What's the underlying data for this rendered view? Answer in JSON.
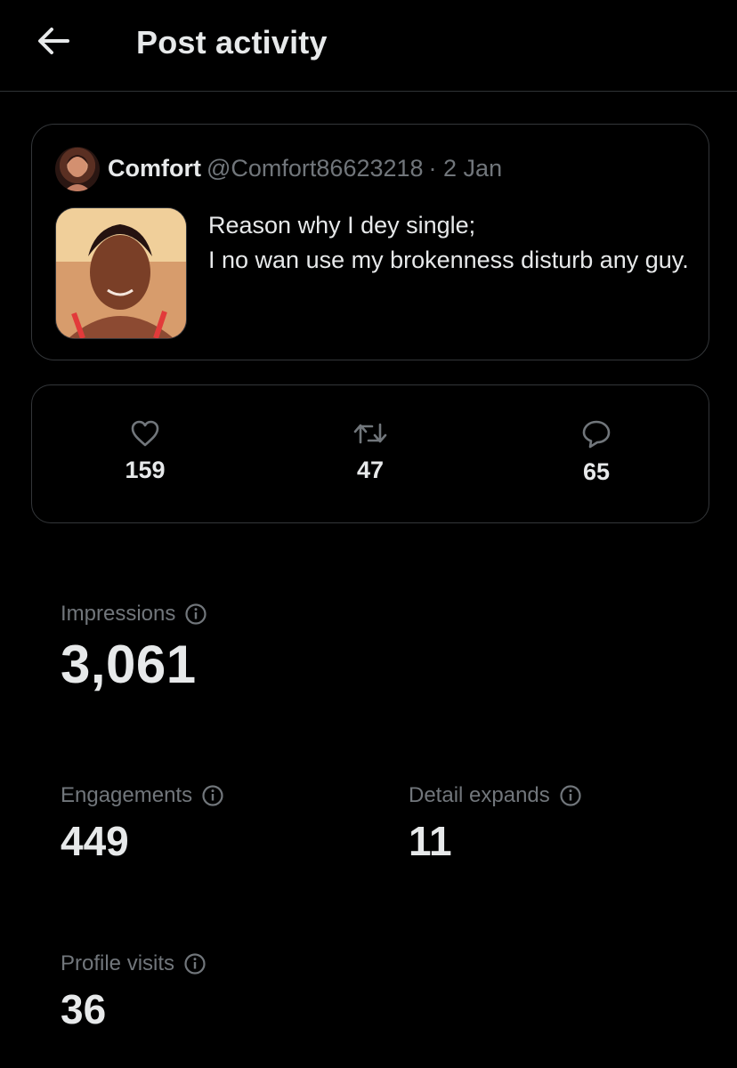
{
  "header": {
    "title": "Post activity"
  },
  "post": {
    "author_name": "Comfort",
    "author_handle": "@Comfort86623218",
    "date": "· 2 Jan",
    "text_lines": [
      "Reason why I dey single;",
      "I no wan use my brokenness disturb any guy."
    ]
  },
  "metrics": {
    "likes": "159",
    "reposts": "47",
    "replies": "65"
  },
  "stats": {
    "impressions": {
      "label": "Impressions",
      "value": "3,061"
    },
    "engagements": {
      "label": "Engagements",
      "value": "449"
    },
    "detail_expands": {
      "label": "Detail expands",
      "value": "11"
    },
    "profile_visits": {
      "label": "Profile visits",
      "value": "36"
    }
  },
  "icons": [
    "back-arrow-icon",
    "heart-icon",
    "repost-icon",
    "reply-icon",
    "info-icon"
  ],
  "colors": {
    "background": "#000000",
    "text": "#e7e9ea",
    "muted": "#71767b",
    "border": "#333639"
  }
}
